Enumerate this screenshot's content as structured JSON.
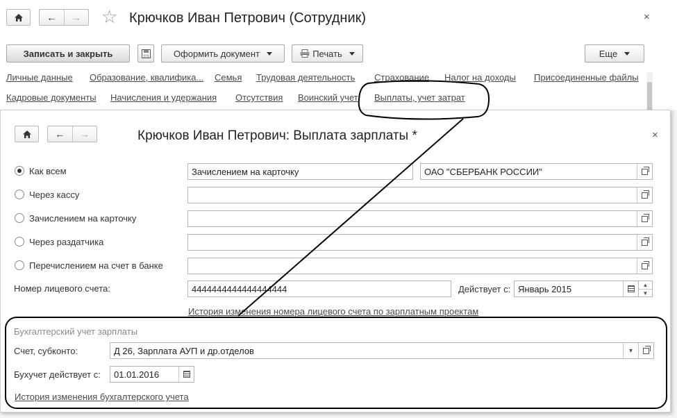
{
  "back_window": {
    "title": "Крючков Иван Петрович (Сотрудник)",
    "close": "×",
    "toolbar": {
      "save_close": "Записать и закрыть",
      "format_doc": "Оформить документ",
      "print": "Печать",
      "more": "Еще"
    },
    "tabs_row1": [
      "Личные данные",
      "Образование, квалифика...",
      "Семья",
      "Трудовая деятельность",
      "Страхование",
      "Налог на доходы",
      "Присоединенные файлы"
    ],
    "tabs_row2": [
      "Кадровые документы",
      "Начисления и удержания",
      "Отсутствия",
      "Воинский учет",
      "Выплаты, учет затрат"
    ]
  },
  "dialog": {
    "title": "Крючков Иван Петрович: Выплата зарплаты *",
    "close": "×",
    "payment_options": [
      {
        "label": "Как всем",
        "checked": true,
        "value1": "Зачислением на карточку",
        "value2": "ОАО \"СБЕРБАНК РОССИИ\""
      },
      {
        "label": "Через кассу",
        "checked": false,
        "value": ""
      },
      {
        "label": "Зачислением на карточку",
        "checked": false,
        "value": ""
      },
      {
        "label": "Через раздатчика",
        "checked": false,
        "value": ""
      },
      {
        "label": "Перечислением на счет в банке",
        "checked": false,
        "value": ""
      }
    ],
    "account_label": "Номер лицевого счета:",
    "account_value": "4444444444444444444",
    "valid_from_label": "Действует с:",
    "valid_from_value": "Январь 2015",
    "account_history_link": "История изменения номера лицевого счета по зарплатным проектам",
    "accounting": {
      "section_title": "Бухгалтерский учет зарплаты",
      "subconto_label": "Счет, субконто:",
      "subconto_value": "Д 26, Зарплата АУП и др.отделов",
      "date_label": "Бухучет действует с:",
      "date_value": "01.01.2016",
      "history_link": "История изменения бухгалтерского учета"
    }
  },
  "annotation_color": "#000000"
}
